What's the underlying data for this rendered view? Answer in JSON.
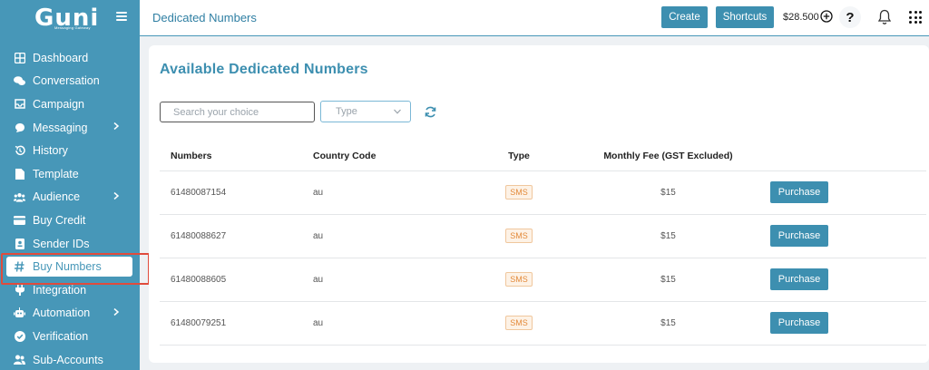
{
  "brand": {
    "logo": "Guni",
    "tagline": "Messaging Gateway"
  },
  "sidebar": {
    "items": [
      {
        "label": "Dashboard",
        "icon": "dashboard-icon"
      },
      {
        "label": "Conversation",
        "icon": "chat-icon"
      },
      {
        "label": "Campaign",
        "icon": "inbox-icon"
      },
      {
        "label": "Messaging",
        "icon": "message-icon",
        "has_submenu": true
      },
      {
        "label": "History",
        "icon": "history-icon"
      },
      {
        "label": "Template",
        "icon": "document-icon"
      },
      {
        "label": "Audience",
        "icon": "users-icon",
        "has_submenu": true
      },
      {
        "label": "Buy Credit",
        "icon": "credit-card-icon"
      },
      {
        "label": "Sender IDs",
        "icon": "id-card-icon"
      },
      {
        "label": "Buy Numbers",
        "icon": "hash-icon",
        "active": true
      },
      {
        "label": "Integration",
        "icon": "plug-icon"
      },
      {
        "label": "Automation",
        "icon": "robot-icon",
        "has_submenu": true
      },
      {
        "label": "Verification",
        "icon": "check-circle-icon"
      },
      {
        "label": "Sub-Accounts",
        "icon": "users-icon"
      }
    ]
  },
  "header": {
    "title": "Dedicated Numbers",
    "create_label": "Create",
    "shortcuts_label": "Shortcuts",
    "balance": "$28.500",
    "help_label": "?"
  },
  "main": {
    "title": "Available Dedicated Numbers",
    "search_placeholder": "Search your choice",
    "type_placeholder": "Type",
    "columns": [
      "Numbers",
      "Country Code",
      "Type",
      "Monthly Fee (GST Excluded)"
    ],
    "rows": [
      {
        "number": "61480087154",
        "country": "au",
        "type": "SMS",
        "fee": "$15",
        "action": "Purchase"
      },
      {
        "number": "61480088627",
        "country": "au",
        "type": "SMS",
        "fee": "$15",
        "action": "Purchase"
      },
      {
        "number": "61480088605",
        "country": "au",
        "type": "SMS",
        "fee": "$15",
        "action": "Purchase"
      },
      {
        "number": "61480079251",
        "country": "au",
        "type": "SMS",
        "fee": "$15",
        "action": "Purchase"
      }
    ]
  },
  "colors": {
    "primary": "#4797b8",
    "accent": "#3d8fb0",
    "badge": "#e38a3a",
    "highlight": "#e04b3c"
  }
}
